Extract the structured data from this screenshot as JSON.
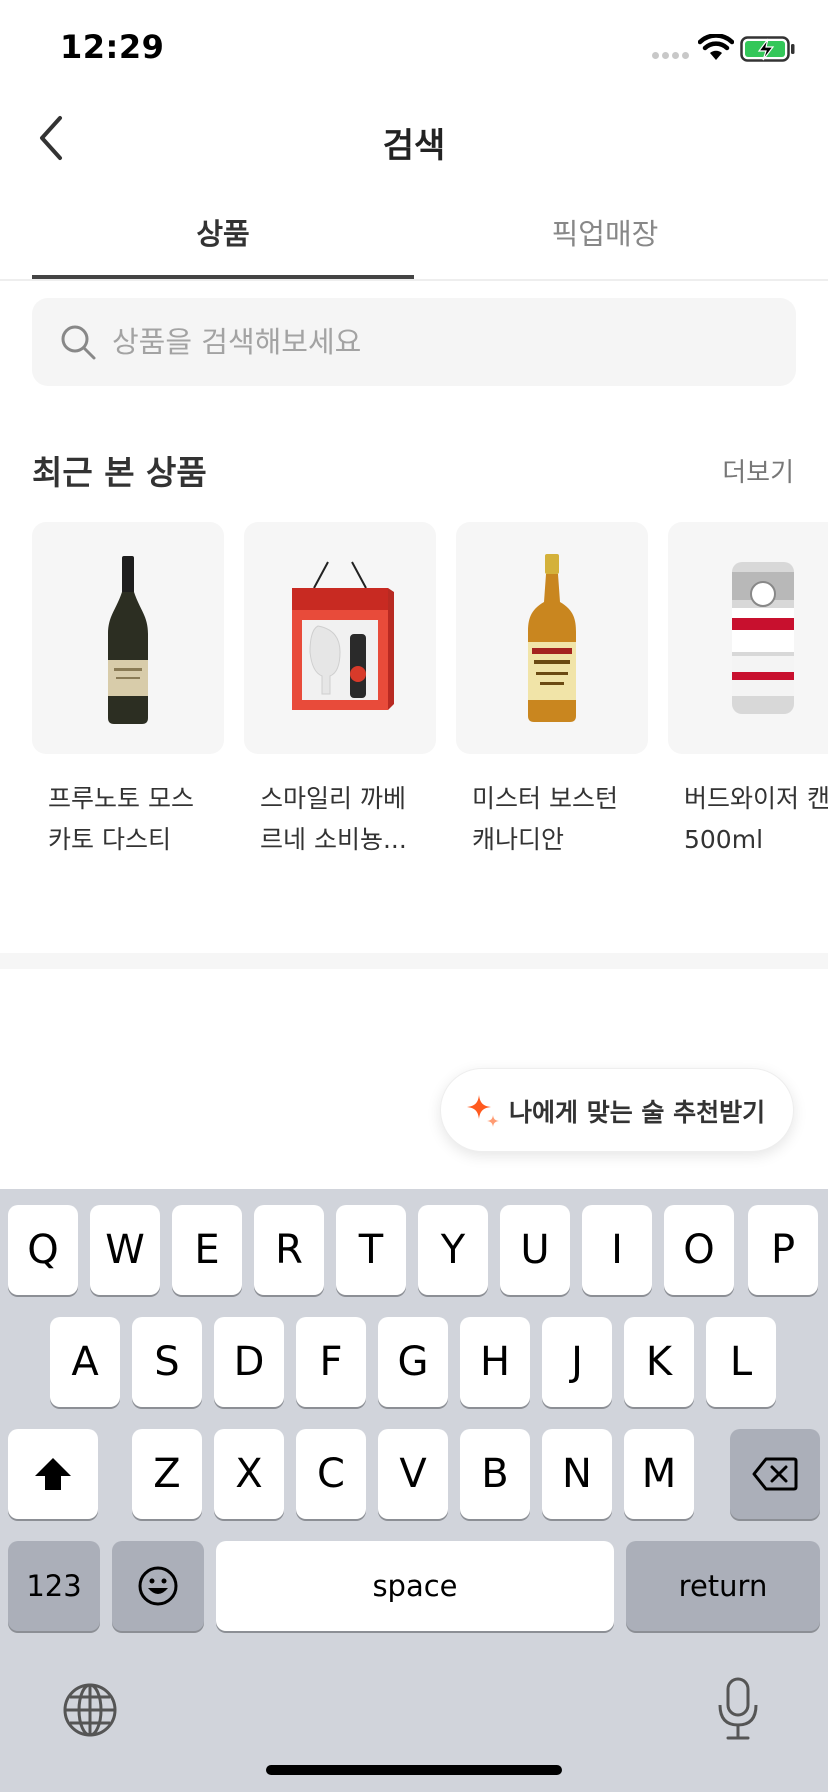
{
  "status_bar": {
    "time": "12:29"
  },
  "header": {
    "title": "검색",
    "back_icon": "chevron-left-icon"
  },
  "tabs": [
    {
      "label": "상품",
      "active": true
    },
    {
      "label": "픽업매장",
      "active": false
    }
  ],
  "search": {
    "placeholder": "상품을 검색해보세요",
    "value": ""
  },
  "recent": {
    "title": "최근 본 상품",
    "more_label": "더보기",
    "items": [
      {
        "name": "프루노토 모스\n카토 다스티",
        "image": "white-wine-bottle"
      },
      {
        "name": "스마일리 까베\n르네 소비뇽...",
        "image": "wine-gift-box"
      },
      {
        "name": "미스터 보스턴\n캐나디안",
        "image": "whisky-bottle"
      },
      {
        "name": "버드와이저 캔\n500ml",
        "image": "beer-can"
      }
    ]
  },
  "recommend_button": {
    "label": "나에게 맞는 술 추천받기",
    "icon": "sparkle-icon"
  },
  "keyboard": {
    "row1": [
      "Q",
      "W",
      "E",
      "R",
      "T",
      "Y",
      "U",
      "I",
      "O",
      "P"
    ],
    "row2": [
      "A",
      "S",
      "D",
      "F",
      "G",
      "H",
      "J",
      "K",
      "L"
    ],
    "row3": [
      "Z",
      "X",
      "C",
      "V",
      "B",
      "N",
      "M"
    ],
    "numbers_label": "123",
    "space_label": "space",
    "return_label": "return"
  },
  "colors": {
    "accent": "#ff5a1f",
    "tab_active": "#444444",
    "keyboard_bg": "#d1d4db"
  }
}
